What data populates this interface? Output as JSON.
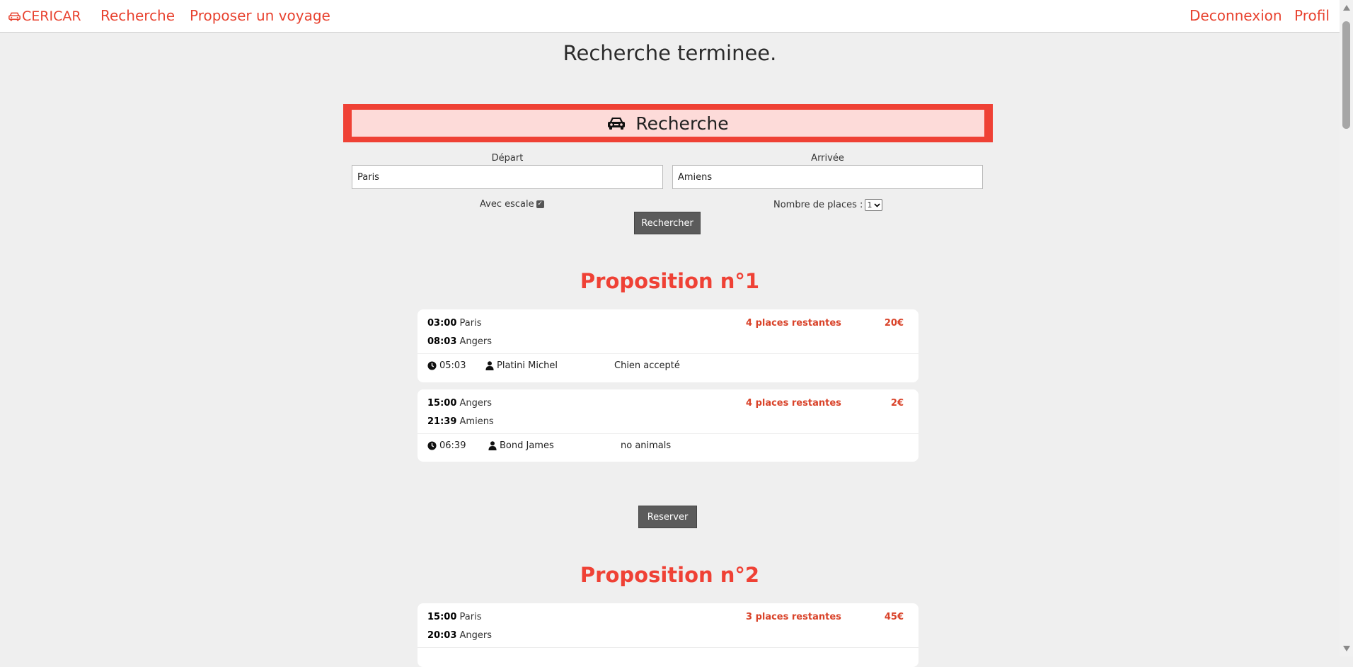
{
  "nav": {
    "logo": "CERICAR",
    "links": [
      "Recherche",
      "Proposer un voyage"
    ],
    "right_links": [
      "Deconnexion",
      "Profil"
    ]
  },
  "page_title": "Recherche terminee.",
  "search": {
    "heading": "Recherche",
    "depart_label": "Départ",
    "depart_value": "Paris",
    "arrivee_label": "Arrivée",
    "arrivee_value": "Amiens",
    "escale_label": "Avec escale",
    "escale_checked": true,
    "places_label": "Nombre de places :",
    "places_value": "1",
    "submit_label": "Rechercher"
  },
  "propositions": [
    {
      "title": "Proposition n°1",
      "trips": [
        {
          "dep_time": "03:00",
          "dep_city": "Paris",
          "arr_time": "08:03",
          "arr_city": "Angers",
          "places": "4 places restantes",
          "price": "20€",
          "duration": "05:03",
          "driver": "Platini Michel",
          "note": "Chien accepté"
        },
        {
          "dep_time": "15:00",
          "dep_city": "Angers",
          "arr_time": "21:39",
          "arr_city": "Amiens",
          "places": "4 places restantes",
          "price": "2€",
          "duration": "06:39",
          "driver": "Bond James",
          "note": "no animals"
        }
      ],
      "reserve_label": "Reserver"
    },
    {
      "title": "Proposition n°2",
      "trips": [
        {
          "dep_time": "15:00",
          "dep_city": "Paris",
          "arr_time": "20:03",
          "arr_city": "Angers",
          "places": "3 places restantes",
          "price": "45€"
        }
      ]
    }
  ],
  "colors": {
    "accent": "#ef4135",
    "search_bg": "#fddbd9",
    "page_bg": "#efefef"
  },
  "icons": [
    "car-icon",
    "clock-icon",
    "user-icon",
    "check-icon",
    "chevron-down-icon"
  ]
}
